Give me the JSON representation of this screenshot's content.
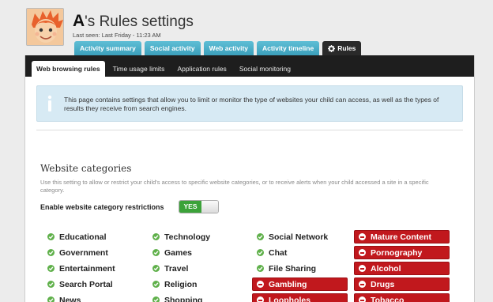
{
  "header": {
    "title_initial": "A",
    "title_rest": "'s Rules settings",
    "last_seen": "Last seen: Last Friday - 11:23 AM"
  },
  "tabs": [
    {
      "label": "Activity summary"
    },
    {
      "label": "Social activity"
    },
    {
      "label": "Web activity"
    },
    {
      "label": "Activity timeline"
    },
    {
      "label": "Rules",
      "icon": "gear-icon",
      "active": true
    }
  ],
  "subtabs": [
    {
      "label": "Web browsing rules",
      "active": true
    },
    {
      "label": "Time usage limits"
    },
    {
      "label": "Application rules"
    },
    {
      "label": "Social monitoring"
    }
  ],
  "info": {
    "text": "This page contains settings that allow you to limit or monitor the type of websites your child can access, as well as the types of results they receive from search engines."
  },
  "website_categories": {
    "title": "Website categories",
    "description": "Use this setting to allow or restrict your child's access to specific website categories, or to receive alerts when your child accessed a site in a specific category.",
    "toggle_label": "Enable website category restrictions",
    "toggle_value": "YES",
    "columns": [
      [
        "Educational",
        "Government",
        "Entertainment",
        "Search Portal",
        "News"
      ],
      [
        "Technology",
        "Games",
        "Travel",
        "Religion",
        "Shopping"
      ],
      [
        "Social Network",
        "Chat",
        "File Sharing",
        "Gambling",
        "Loopholes"
      ],
      [
        "Mature Content",
        "Pornography",
        "Alcohol",
        "Drugs",
        "Tobacco"
      ]
    ],
    "blocked": [
      "Gambling",
      "Loopholes",
      "Mature Content",
      "Pornography",
      "Alcohol",
      "Drugs",
      "Tobacco"
    ]
  },
  "colors": {
    "tab": "#3b9fbb",
    "allowed": "#5fb04a",
    "blocked": "#c1181d",
    "toggle_on": "#3ba239"
  }
}
